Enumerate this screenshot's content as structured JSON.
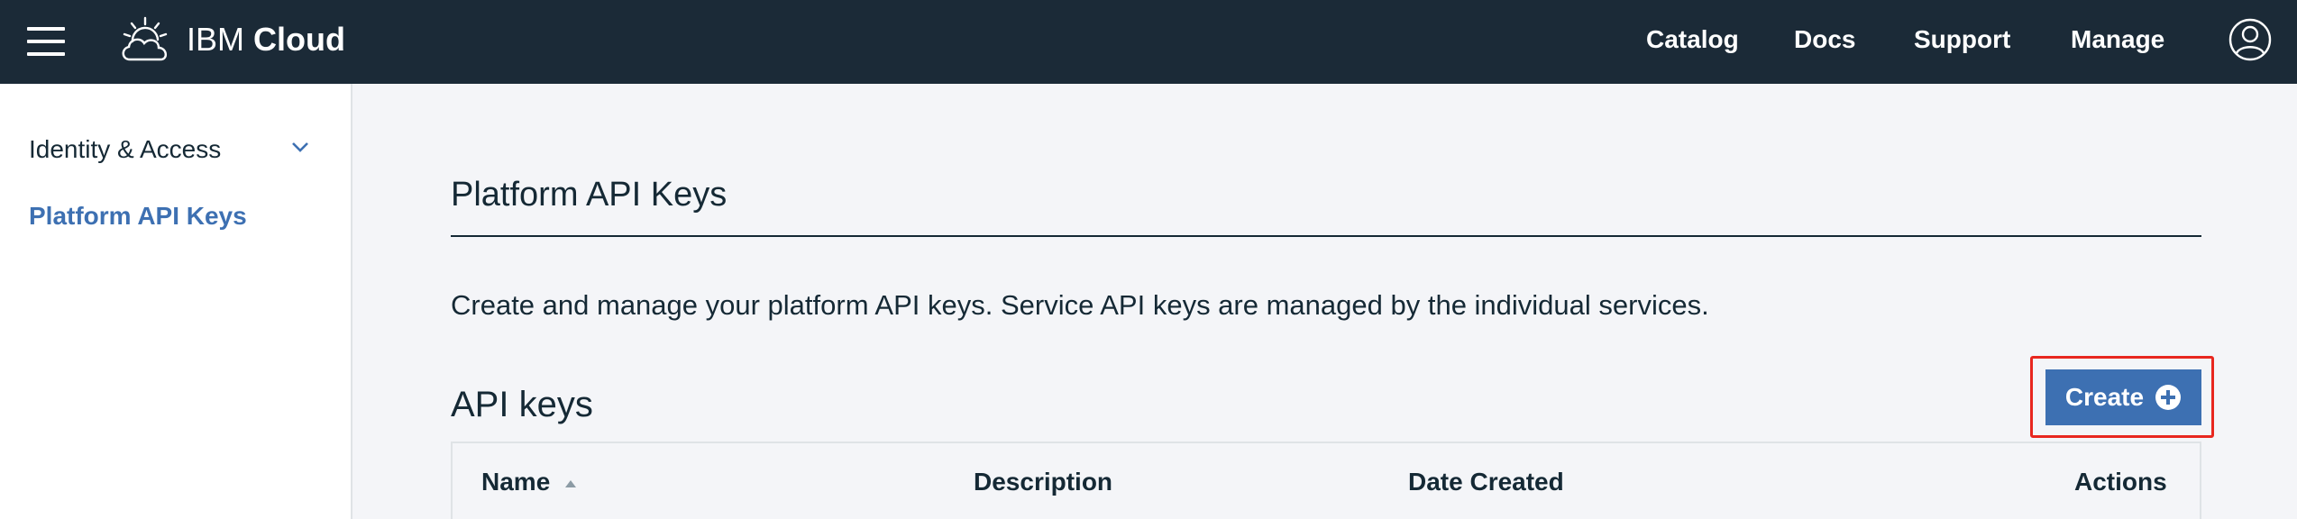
{
  "header": {
    "brand_light": "IBM ",
    "brand_bold": "Cloud",
    "nav": {
      "catalog": "Catalog",
      "docs": "Docs",
      "support": "Support",
      "manage": "Manage"
    },
    "menu_icon": "hamburger-icon",
    "logo_icon": "cloud-sun-icon",
    "avatar_icon": "user-avatar-icon"
  },
  "sidebar": {
    "items": [
      {
        "label": "Identity & Access",
        "expandable": true
      },
      {
        "label": "Platform API Keys",
        "active": true
      }
    ]
  },
  "main": {
    "page_title": "Platform API Keys",
    "description": "Create and manage your platform API keys. Service API keys are managed by the individual services.",
    "section_title": "API keys",
    "create_button": "Create",
    "table": {
      "columns": [
        "Name",
        "Description",
        "Date Created",
        "Actions"
      ],
      "sort_column": "Name",
      "sort_direction": "ascending"
    }
  },
  "colors": {
    "topbar": "#1b2a37",
    "accent": "#3d70b2",
    "highlight": "#e8271f",
    "text": "#152935"
  }
}
